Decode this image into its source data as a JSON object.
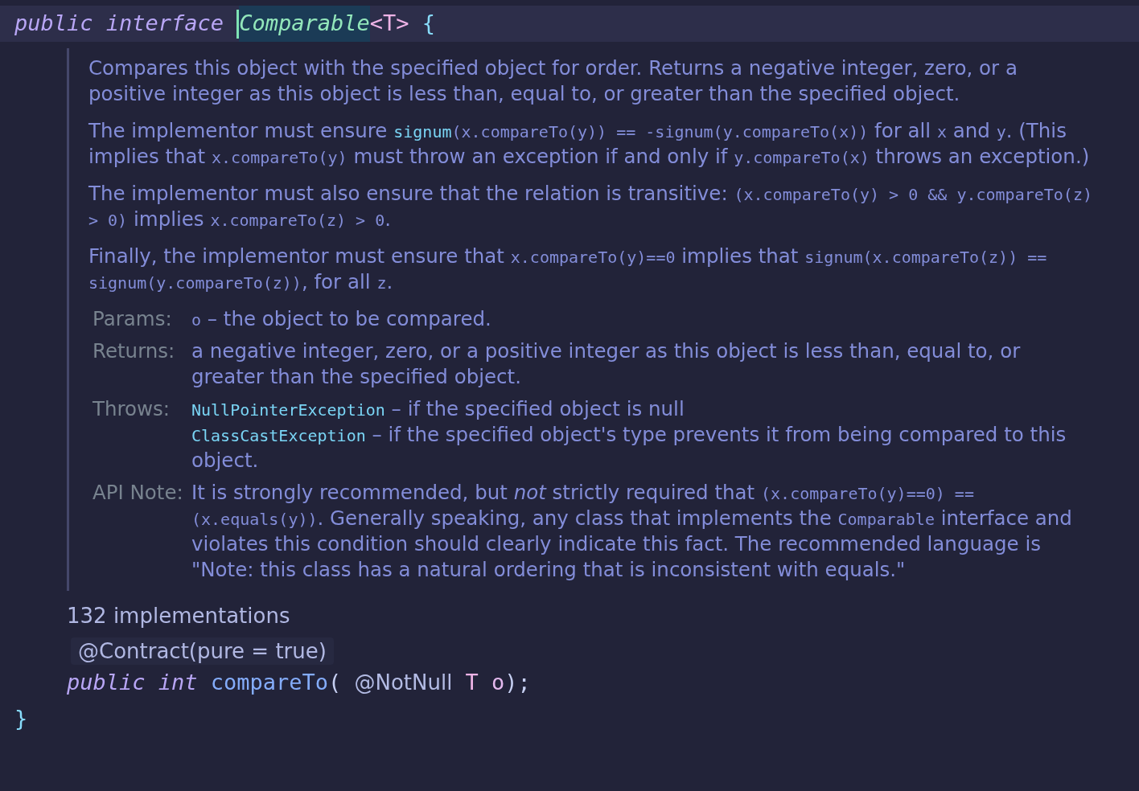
{
  "lines": [
    {
      "kind": "code",
      "current": true,
      "groups": [
        [
          {
            "kind": "keyword",
            "text": "public",
            "cursor": false
          }
        ],
        [
          {
            "kind": "keyword",
            "text": "interface",
            "cursor": false
          }
        ],
        [
          {
            "kind": "type",
            "text": "Comparable",
            "cursor": true
          },
          {
            "kind": "type_param",
            "text": "<T>",
            "cursor": false
          }
        ],
        [
          {
            "kind": "brace",
            "text": "{",
            "cursor": false
          }
        ]
      ],
      "children": [
        {
          "kind": "doc",
          "paragraphs": [
            [
              {
                "kind": "text",
                "text": "Compares this object with the specified object for order. Returns a negative integer, zero, or a positive integer as this object is less than, equal to, or greater than the specified object."
              }
            ],
            [
              {
                "kind": "text",
                "text": "The implementor must ensure "
              },
              {
                "kind": "link",
                "text": "signum"
              },
              {
                "kind": "code",
                "text": "(x.compareTo(y)) == -signum(y.compareTo(x))"
              },
              {
                "kind": "text",
                "text": " for all "
              },
              {
                "kind": "code",
                "text": "x"
              },
              {
                "kind": "text",
                "text": " and "
              },
              {
                "kind": "code",
                "text": "y"
              },
              {
                "kind": "text",
                "text": ". (This implies that "
              },
              {
                "kind": "code",
                "text": "x.compareTo(y)"
              },
              {
                "kind": "text",
                "text": " must throw an exception if and only if "
              },
              {
                "kind": "code",
                "text": "y.compareTo(x)"
              },
              {
                "kind": "text",
                "text": " throws an exception.)"
              }
            ],
            [
              {
                "kind": "text",
                "text": "The implementor must also ensure that the relation is transitive: "
              },
              {
                "kind": "code",
                "text": "(x.compareTo(y) > 0 && y.compareTo(z) > 0)"
              },
              {
                "kind": "text",
                "text": " implies "
              },
              {
                "kind": "code",
                "text": "x.compareTo(z) > 0"
              },
              {
                "kind": "text",
                "text": "."
              }
            ],
            [
              {
                "kind": "text",
                "text": "Finally, the implementor must ensure that "
              },
              {
                "kind": "code",
                "text": "x.compareTo(y)==0"
              },
              {
                "kind": "text",
                "text": " implies that "
              },
              {
                "kind": "code",
                "text": "signum(x.compareTo(z)) == signum(y.compareTo(z))"
              },
              {
                "kind": "text",
                "text": ", for all "
              },
              {
                "kind": "code",
                "text": "z"
              },
              {
                "kind": "text",
                "text": "."
              }
            ]
          ],
          "tags": [
            {
              "label": "Params:",
              "entries": [
                [
                  {
                    "kind": "code",
                    "text": "o"
                  },
                  {
                    "kind": "text",
                    "text": " – the object to be compared."
                  }
                ]
              ]
            },
            {
              "label": "Returns:",
              "entries": [
                [
                  {
                    "kind": "text",
                    "text": "a negative integer, zero, or a positive integer as this object is less than, equal to, or greater than the specified object."
                  }
                ]
              ]
            },
            {
              "label": "Throws:",
              "entries": [
                [
                  {
                    "kind": "link",
                    "text": "NullPointerException"
                  },
                  {
                    "kind": "text",
                    "text": " – if the specified object is null"
                  }
                ],
                [
                  {
                    "kind": "link",
                    "text": "ClassCastException"
                  },
                  {
                    "kind": "text",
                    "text": " – if the specified object's type prevents it from being compared to this object."
                  }
                ]
              ]
            },
            {
              "label": "API Note:",
              "entries": [
                [
                  {
                    "kind": "text",
                    "text": "It is strongly recommended, but *not* strictly required that "
                  },
                  {
                    "kind": "code",
                    "text": "(x.compareTo(y)==0) == (x.equals(y))"
                  },
                  {
                    "kind": "text",
                    "text": ". Generally speaking, any class that implements the "
                  },
                  {
                    "kind": "code",
                    "text": "Comparable"
                  },
                  {
                    "kind": "text",
                    "text": " interface and violates this condition should clearly indicate this fact. The recommended language is \"Note: this class has a natural ordering that is inconsistent with equals.\""
                  }
                ]
              ]
            }
          ]
        },
        {
          "kind": "hint",
          "text": "132 implementations"
        },
        {
          "kind": "inlay",
          "text": "@Contract(pure = true)"
        },
        {
          "kind": "code",
          "current": false,
          "groups": [
            [
              {
                "kind": "keyword",
                "text": "public",
                "cursor": false
              }
            ],
            [
              {
                "kind": "keyword",
                "text": "int",
                "cursor": false
              }
            ],
            [
              {
                "kind": "method",
                "text": "compareTo",
                "cursor": false
              },
              {
                "kind": "punct",
                "text": "(",
                "cursor": false
              }
            ],
            [
              {
                "kind": "inlay",
                "text": "@NotNull",
                "cursor": false
              }
            ],
            [
              {
                "kind": "type_param",
                "text": "T",
                "cursor": false
              }
            ],
            [
              {
                "kind": "param",
                "text": "o",
                "cursor": false
              },
              {
                "kind": "punct",
                "text": ");",
                "cursor": false
              }
            ]
          ]
        }
      ]
    },
    {
      "kind": "code",
      "current": false,
      "groups": [
        [
          {
            "kind": "brace",
            "text": "}",
            "cursor": false
          }
        ]
      ]
    }
  ]
}
